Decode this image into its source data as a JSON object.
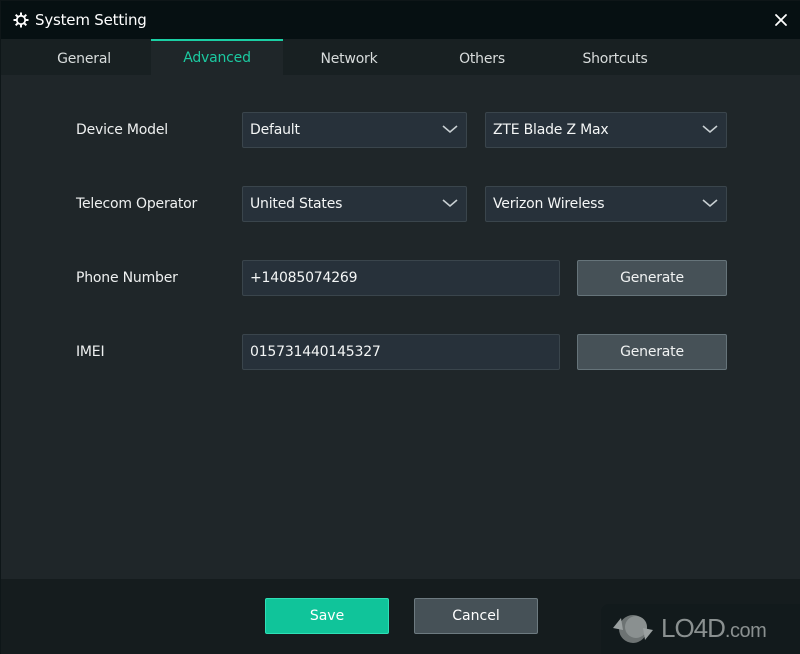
{
  "window": {
    "title": "System Setting",
    "title_icon": "gear-icon",
    "close_icon": "close-icon"
  },
  "tabs": [
    {
      "label": "General",
      "active": false
    },
    {
      "label": "Advanced",
      "active": true
    },
    {
      "label": "Network",
      "active": false
    },
    {
      "label": "Others",
      "active": false
    },
    {
      "label": "Shortcuts",
      "active": false
    }
  ],
  "form": {
    "device_model": {
      "label": "Device Model",
      "brand_value": "Default",
      "model_value": "ZTE Blade Z Max"
    },
    "telecom_operator": {
      "label": "Telecom Operator",
      "country_value": "United States",
      "carrier_value": "Verizon Wireless"
    },
    "phone_number": {
      "label": "Phone Number",
      "value": "+14085074269",
      "generate_label": "Generate"
    },
    "imei": {
      "label": "IMEI",
      "value": "015731440145327",
      "generate_label": "Generate"
    }
  },
  "footer": {
    "save_label": "Save",
    "cancel_label": "Cancel"
  },
  "watermark": {
    "text": "LO4D",
    "suffix": ".com"
  },
  "colors": {
    "accent": "#1bc9a0",
    "save_button": "#10c49a",
    "background": "#1f2629",
    "titlebar": "#061012"
  }
}
